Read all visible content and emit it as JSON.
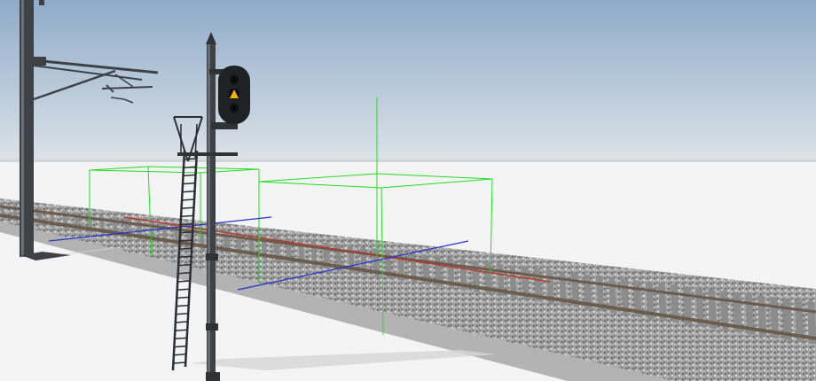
{
  "scene": {
    "sky_color_top": "#8fabc9",
    "sky_color_horizon": "#dde3e8",
    "ground_color": "#f4f4f5",
    "rail_color": "#6b5c4e",
    "sleeper_color": "#8c8c8c",
    "ballast_color": "#9a9a9a",
    "embankment_color": "#b3b3b3",
    "mast_color": "#3e4246",
    "signal_head_color": "#1e2225",
    "signal_aspect_color": "#f2b300",
    "gizmo_box_color": "#22dd22",
    "gizmo_axis_color": "#2233cc"
  }
}
